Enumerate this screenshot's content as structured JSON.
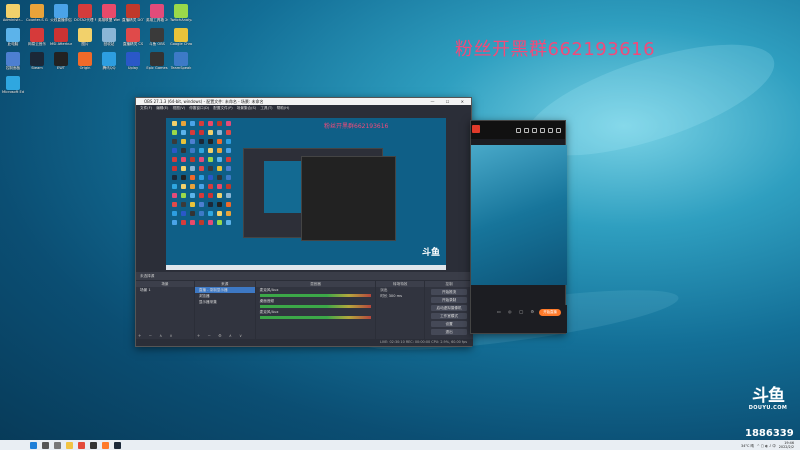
{
  "watermark": "粉丝开黑群662193616",
  "douyu": {
    "mark": "斗鱼",
    "name": "DOUYU.COM",
    "room": "1886339"
  },
  "desktop_icons": [
    {
      "label": "Administr...",
      "color": "#f2d16b"
    },
    {
      "label": "Counter-S Global Off",
      "color": "#e8a33a"
    },
    {
      "label": "火线直播伴侣",
      "color": "#4aa3e8"
    },
    {
      "label": "DOTA2代理 PC",
      "color": "#d43c3c"
    },
    {
      "label": "英雄联盟 WeGame",
      "color": "#e84a6a"
    },
    {
      "label": "直播精灵 DOTA2",
      "color": "#c0392b"
    },
    {
      "label": "英雄工具箱 2022",
      "color": "#e24b7a"
    },
    {
      "label": "TwitchAnalyzer",
      "color": "#9ad94a"
    },
    {
      "label": "此电脑",
      "color": "#5cb3ea"
    },
    {
      "label": "网易云音乐",
      "color": "#d63a3a"
    },
    {
      "label": "MSI Afterburner",
      "color": "#c33"
    },
    {
      "label": "图片",
      "color": "#f2d16b"
    },
    {
      "label": "回收站",
      "color": "#8ab6d6"
    },
    {
      "label": "直播精灵 CS",
      "color": "#e04a4a"
    },
    {
      "label": "斗鱼 OBS",
      "color": "#3a3a3a"
    },
    {
      "label": "Google Chrome",
      "color": "#e8c33a"
    },
    {
      "label": "控制面板",
      "color": "#4d7fd1"
    },
    {
      "label": "Steam",
      "color": "#1b2838"
    },
    {
      "label": "EWT",
      "color": "#222"
    },
    {
      "label": "Origin",
      "color": "#f06a2a"
    },
    {
      "label": "腾讯QQ",
      "color": "#2d9ee0"
    },
    {
      "label": "Uplay",
      "color": "#2a58c8"
    },
    {
      "label": "Epic Games",
      "color": "#333"
    },
    {
      "label": "TeamSpeak",
      "color": "#3d7ac7"
    },
    {
      "label": "Microsoft Edge",
      "color": "#2fa7e0"
    }
  ],
  "obs": {
    "title": "OBS 27.1.3 (64-bit, windows) - 配置文件: 未命名 - 场景: 未命名",
    "menu": "文件(F)  编辑(E)  视图(V)  停靠窗口(D)  配置文件(P)  场景集合(S)  工具(T)  帮助(H)",
    "strip": "未选择源",
    "scenes_header": "场景",
    "sources_header": "来源",
    "mixer_header": "混音器",
    "transitions_header": "转场特效",
    "controls_header": "控制",
    "scene_item": "场景 1",
    "sources": [
      "直播 - 录制显示器",
      "浏览器",
      "显示器采集"
    ],
    "mixer_tracks": [
      "麦克风/Aux",
      "桌面音频",
      "麦克风/Aux"
    ],
    "transition_mode": "淡出",
    "transition_duration_label": "时长",
    "transition_duration": "300 ms",
    "control_buttons": [
      "开始推流",
      "开始录制",
      "启动虚拟摄像机",
      "工作室模式",
      "设置",
      "退出"
    ],
    "status": "LIVE: 02:30:10   REC: 00:00:00   CPU: 2.9%, 60.00 fps"
  },
  "taskbar": {
    "time": "19:46",
    "date": "2022/2/2",
    "tray_text": "34°C 晴"
  }
}
